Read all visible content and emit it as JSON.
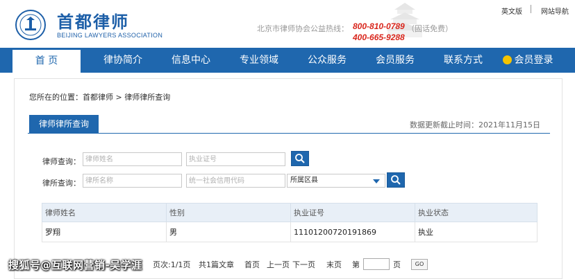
{
  "header": {
    "logo_cn": "首都律师",
    "logo_en": "BEIJING LAWYERS ASSOCIATION",
    "hotline_label": "北京市律师协会公益热线：",
    "hotline_number_1": "800-810-0789",
    "hotline_note": "（固话免费）",
    "hotline_number_2": "400-665-9288",
    "link_english": "英文版",
    "link_sitemap": "网站导航"
  },
  "nav": {
    "items": [
      {
        "label": "首 页",
        "active": true
      },
      {
        "label": "律协简介"
      },
      {
        "label": "信息中心"
      },
      {
        "label": "专业领域"
      },
      {
        "label": "公众服务"
      },
      {
        "label": "会员服务"
      },
      {
        "label": "联系方式"
      },
      {
        "label": "会员登录"
      }
    ]
  },
  "breadcrumb": {
    "text": "您所在的位置：首都律师 > 律师律所查询"
  },
  "section": {
    "tab_label": "律师律所查询",
    "update_text": "数据更新截止时间：2021年11月15日"
  },
  "search": {
    "lawyer_label": "律师查询：",
    "lawyer_name_placeholder": "律师姓名",
    "license_placeholder": "执业证号",
    "firm_label": "律所查询：",
    "firm_name_placeholder": "律所名称",
    "credit_code_placeholder": "统一社会信用代码",
    "district_selected": "所属区县"
  },
  "results": {
    "columns": [
      "律师姓名",
      "性别",
      "执业证号",
      "执业状态"
    ],
    "rows": [
      [
        "罗翔",
        "男",
        "11101200720191869",
        "执业"
      ]
    ]
  },
  "pager": {
    "pages": "页次:1/1页",
    "total": "共1篇文章",
    "first": "首页",
    "prev": "上一页",
    "next": "下一页",
    "last": "末页",
    "goto_prefix": "第",
    "goto_suffix": "页",
    "go": "GO"
  },
  "watermark": "搜狐号@互联网营销-吴学涯",
  "colors": {
    "brand_blue": "#1f67ae",
    "hotline_red": "#d9261c"
  }
}
